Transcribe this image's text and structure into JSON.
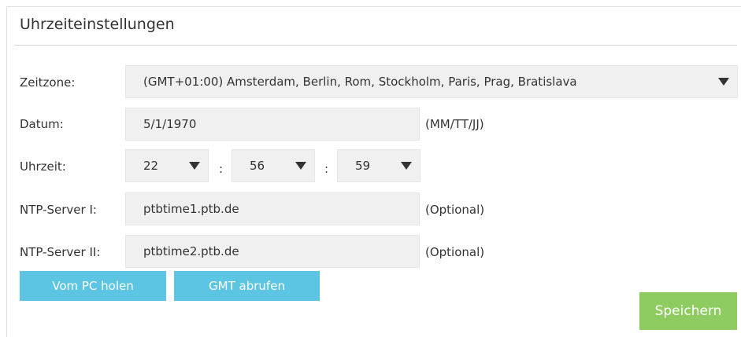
{
  "section_title": "Uhrzeiteinstellungen",
  "timezone": {
    "label": "Zeitzone:",
    "value": "(GMT+01:00) Amsterdam, Berlin, Rom, Stockholm, Paris, Prag, Bratislava"
  },
  "date": {
    "label": "Datum:",
    "value": "5/1/1970",
    "format_hint": "(MM/TT/JJ)"
  },
  "time": {
    "label": "Uhrzeit:",
    "hour": "22",
    "minute": "56",
    "second": "59",
    "separator": ":"
  },
  "ntp1": {
    "label": "NTP-Server I:",
    "value": "ptbtime1.ptb.de",
    "hint": "(Optional)"
  },
  "ntp2": {
    "label": "NTP-Server II:",
    "value": "ptbtime2.ptb.de",
    "hint": "(Optional)"
  },
  "buttons": {
    "from_pc": "Vom PC holen",
    "get_gmt": "GMT abrufen",
    "save": "Speichern"
  },
  "colors": {
    "secondary_button": "#5bc5e3",
    "primary_button": "#8ecb60",
    "field_background": "#f0f0f0"
  },
  "icons": {
    "dropdown": "triangle-down-icon"
  }
}
